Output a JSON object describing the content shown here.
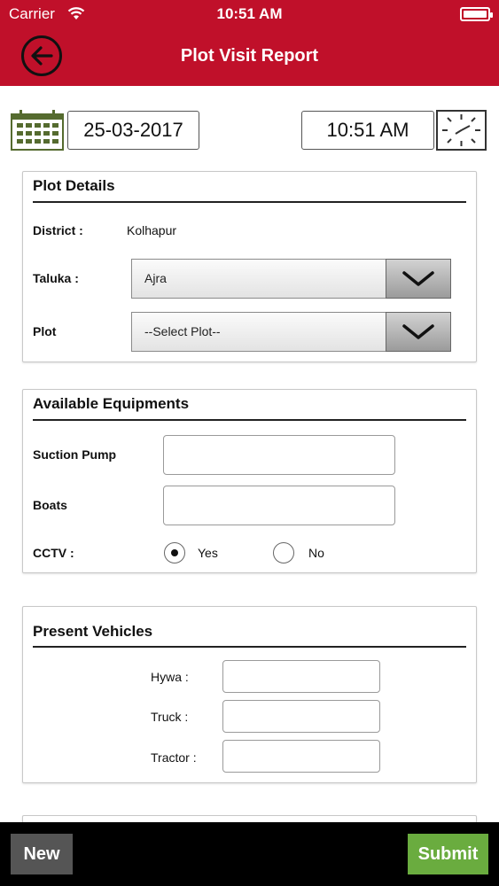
{
  "status_bar": {
    "carrier": "Carrier",
    "time": "10:51 AM"
  },
  "header": {
    "title": "Plot Visit Report",
    "back_icon": "back-arrow-icon",
    "color": "#c0102a"
  },
  "datetime": {
    "date": "25-03-2017",
    "time": "10:51 AM",
    "date_icon": "calendar-icon",
    "time_icon": "clock-icon"
  },
  "plot_details": {
    "title": "Plot Details",
    "district_label": "District :",
    "district_value": "Kolhapur",
    "taluka_label": "Taluka :",
    "taluka_value": "Ajra",
    "plot_label": "Plot",
    "plot_value": "--Select Plot--"
  },
  "equipments": {
    "title": "Available Equipments",
    "suction_pump_label": "Suction Pump",
    "suction_pump_value": "",
    "boats_label": "Boats",
    "boats_value": "",
    "cctv_label": "CCTV :",
    "cctv_options": [
      "Yes",
      "No"
    ],
    "cctv_selected": "Yes"
  },
  "vehicles": {
    "title": "Present Vehicles",
    "hywa_label": "Hywa :",
    "hywa_value": "",
    "truck_label": "Truck :",
    "truck_value": "",
    "tractor_label": "Tractor :",
    "tractor_value": ""
  },
  "footer": {
    "new_label": "New",
    "submit_label": "Submit",
    "submit_color": "#6aac3f"
  }
}
